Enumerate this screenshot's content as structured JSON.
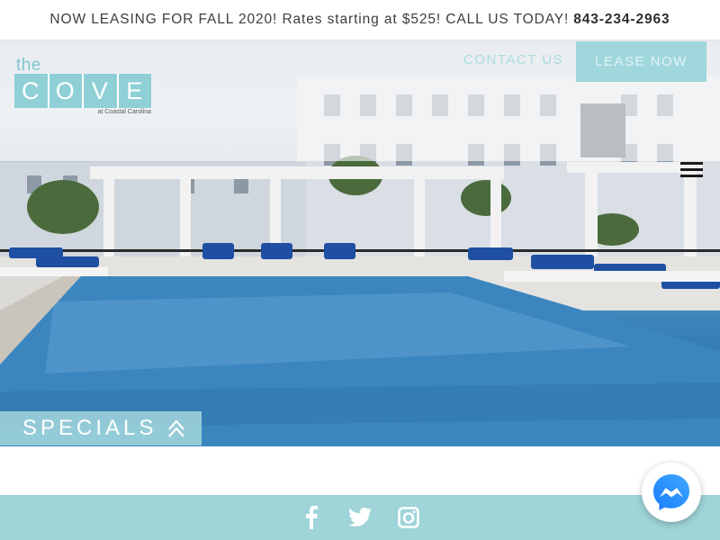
{
  "announcement": {
    "text": "NOW LEASING FOR FALL 2020! Rates starting at $525! CALL US TODAY!",
    "phone": "843-234-2963"
  },
  "logo": {
    "the": "the",
    "letters": [
      "C",
      "O",
      "V",
      "E"
    ],
    "subtitle": "at Coastal Carolina"
  },
  "nav": {
    "contact_label": "CONTACT US",
    "lease_label": "LEASE NOW",
    "menu_icon": "hamburger-menu-icon"
  },
  "hero": {
    "specials_label": "SPECIALS",
    "specials_icon": "double-chevron-up-icon"
  },
  "footer": {
    "social": [
      "facebook-icon",
      "twitter-icon",
      "instagram-icon"
    ]
  },
  "chat": {
    "icon": "messenger-icon"
  },
  "colors": {
    "accent": "#9fd4d9",
    "logo_teal": "#8fd0d6",
    "text_dark": "#3e3e3e"
  }
}
